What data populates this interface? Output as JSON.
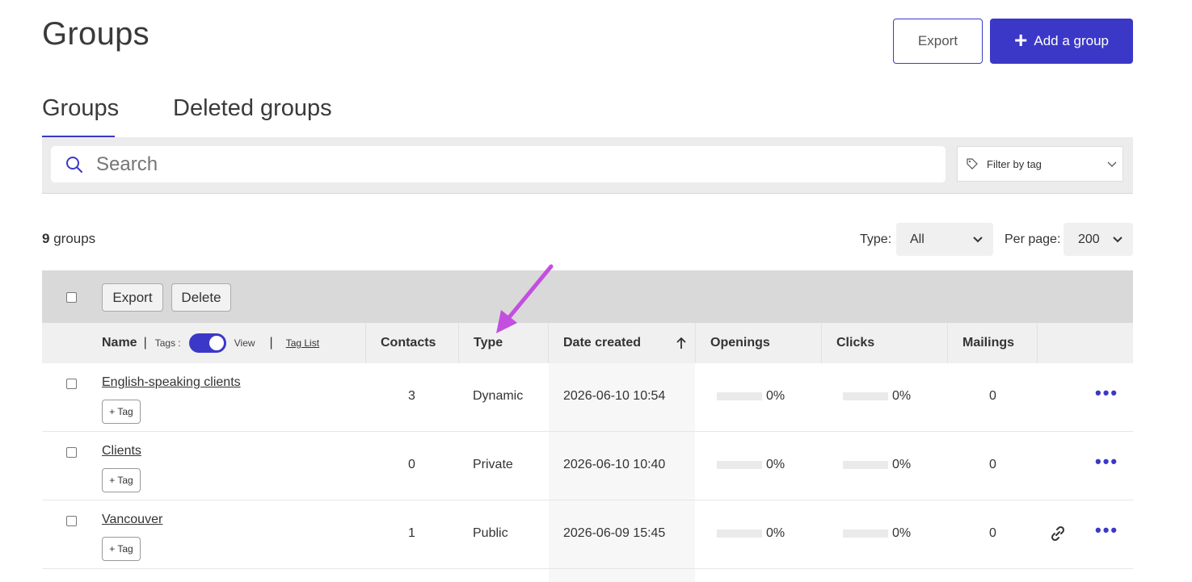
{
  "header": {
    "title": "Groups",
    "export_label": "Export",
    "add_label": "Add a group"
  },
  "tabs": [
    {
      "label": "Groups",
      "active": true
    },
    {
      "label": "Deleted groups",
      "active": false
    }
  ],
  "search": {
    "placeholder": "Search",
    "filter_label": "Filter by tag"
  },
  "summary": {
    "count": "9",
    "count_suffix": "groups"
  },
  "filters": {
    "type_label": "Type:",
    "type_value": "All",
    "per_page_label": "Per page:",
    "per_page_value": "200"
  },
  "bulk": {
    "export_label": "Export",
    "delete_label": "Delete"
  },
  "table": {
    "headers": {
      "name": "Name",
      "tags": "Tags :",
      "view": "View",
      "tag_list": "Tag List",
      "contacts": "Contacts",
      "type": "Type",
      "date_created": "Date created",
      "openings": "Openings",
      "clicks": "Clicks",
      "mailings": "Mailings"
    },
    "rows": [
      {
        "name": "English-speaking clients",
        "tag_label": "+ Tag",
        "contacts": "3",
        "type": "Dynamic",
        "date": "2026-06-10 10:54",
        "openings": "0%",
        "clicks": "0%",
        "mailings": "0",
        "has_link": false
      },
      {
        "name": "Clients",
        "tag_label": "+ Tag",
        "contacts": "0",
        "type": "Private",
        "date": "2026-06-10 10:40",
        "openings": "0%",
        "clicks": "0%",
        "mailings": "0",
        "has_link": false
      },
      {
        "name": "Vancouver",
        "tag_label": "+ Tag",
        "contacts": "1",
        "type": "Public",
        "date": "2026-06-09 15:45",
        "openings": "0%",
        "clicks": "0%",
        "mailings": "0",
        "has_link": true
      }
    ]
  },
  "colors": {
    "accent": "#3b38c8",
    "annotation_arrow": "#c34fe0"
  }
}
